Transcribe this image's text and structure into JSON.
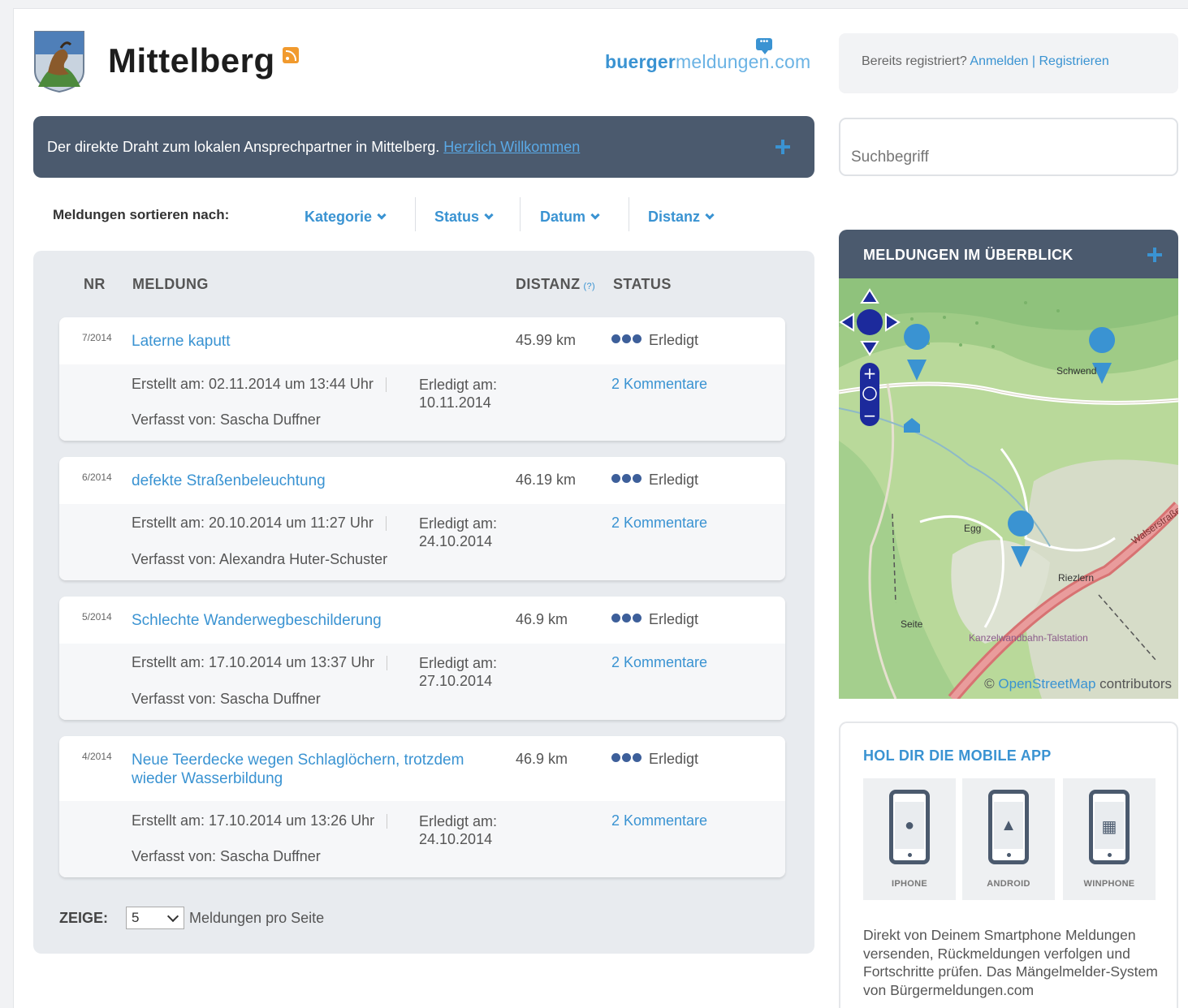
{
  "header": {
    "town_name": "Mittelberg",
    "brand_part1": "buerger",
    "brand_part2": "meldungen.com",
    "login_prompt": "Bereits registriert?",
    "login_link": "Anmelden",
    "register_link": "Registrieren"
  },
  "banner": {
    "text": "Der direkte Draht zum lokalen Ansprechpartner in Mittelberg.",
    "link": "Herzlich Willkommen"
  },
  "search": {
    "placeholder": "Suchbegriff"
  },
  "sort": {
    "label": "Meldungen sortieren nach:",
    "options": [
      "Kategorie",
      "Status",
      "Datum",
      "Distanz"
    ]
  },
  "list": {
    "headers": {
      "nr": "NR",
      "meldung": "MELDUNG",
      "distanz": "DISTANZ",
      "distanz_help": "(?)",
      "status": "STATUS"
    },
    "items": [
      {
        "nr": "7/2014",
        "title": "Laterne kaputt",
        "distance": "45.99 km",
        "status": "Erledigt",
        "created": "Erstellt am: 02.11.2014 um 13:44 Uhr",
        "done_label": "Erledigt am:",
        "done_date": "10.11.2014",
        "comments": "2 Kommentare",
        "author": "Verfasst von: Sascha Duffner"
      },
      {
        "nr": "6/2014",
        "title": "defekte Straßenbeleuchtung",
        "distance": "46.19 km",
        "status": "Erledigt",
        "created": "Erstellt am: 20.10.2014 um 11:27 Uhr",
        "done_label": "Erledigt am:",
        "done_date": "24.10.2014",
        "comments": "2 Kommentare",
        "author": "Verfasst von: Alexandra Huter-Schuster"
      },
      {
        "nr": "5/2014",
        "title": "Schlechte Wanderwegbeschilderung",
        "distance": "46.9 km",
        "status": "Erledigt",
        "created": "Erstellt am: 17.10.2014 um 13:37 Uhr",
        "done_label": "Erledigt am:",
        "done_date": "27.10.2014",
        "comments": "2 Kommentare",
        "author": "Verfasst von: Sascha Duffner"
      },
      {
        "nr": "4/2014",
        "title": "Neue Teerdecke wegen Schlaglöchern, trotzdem wieder Wasserbildung",
        "distance": "46.9 km",
        "status": "Erledigt",
        "created": "Erstellt am: 17.10.2014 um 13:26 Uhr",
        "done_label": "Erledigt am:",
        "done_date": "24.10.2014",
        "comments": "2 Kommentare",
        "author": "Verfasst von: Sascha Duffner"
      }
    ]
  },
  "pager": {
    "label": "ZEIGE:",
    "value": "5",
    "suffix": "Meldungen pro Seite"
  },
  "map": {
    "title": "MELDUNGEN IM ÜBERBLICK",
    "labels": [
      "Schwend",
      "Egg",
      "Riezlern",
      "Seite",
      "Walserstraße",
      "Kanzelwandbahn-Talstation"
    ],
    "attribution_prefix": "©",
    "attribution_link": "OpenStreetMap",
    "attribution_suffix": "contributors"
  },
  "app": {
    "title": "HOL DIR DIE MOBILE APP",
    "platforms": [
      "IPHONE",
      "ANDROID",
      "WINPHONE"
    ],
    "description": "Direkt von Deinem Smartphone Meldungen versenden, Rückmeldungen verfolgen und Fortschritte prüfen. Das Mängelmelder-System von Bürgermeldungen.com"
  },
  "colors": {
    "accent": "#3a93d2",
    "dark": "#4b5a6e",
    "status_dots": "#3d5f9a"
  }
}
